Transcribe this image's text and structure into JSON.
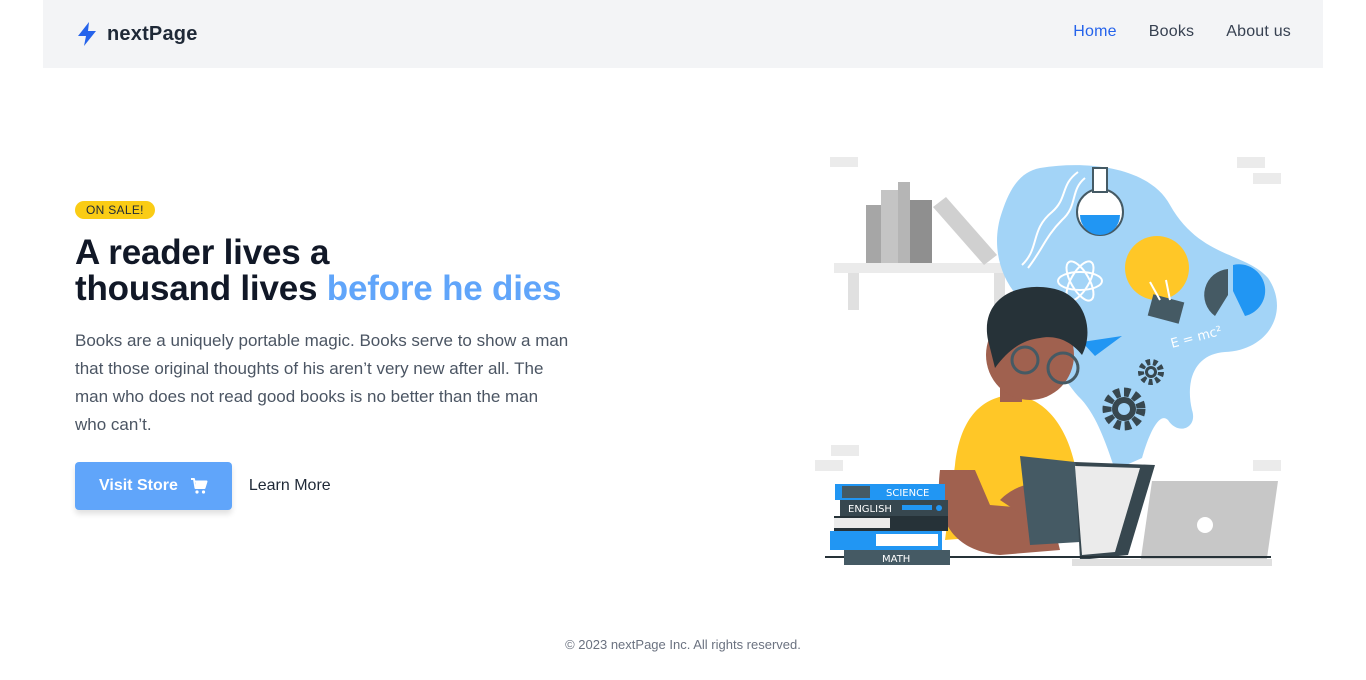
{
  "brand": {
    "name": "nextPage",
    "icon": "lightning-bolt-icon",
    "color": "#2563eb"
  },
  "nav": {
    "items": [
      {
        "label": "Home",
        "active": true
      },
      {
        "label": "Books",
        "active": false
      },
      {
        "label": "About us",
        "active": false
      }
    ]
  },
  "hero": {
    "badge": "ON SALE!",
    "headline_part1": "A reader lives a",
    "headline_part2": "thousand lives ",
    "headline_accent": "before he dies",
    "description": "Books are a uniquely portable magic. Books serve to show a man that those original thoughts of his aren’t very new after all. The man who does not read good books is no better than the man who can’t.",
    "primary_button": "Visit Store",
    "primary_button_icon": "shopping-cart-icon",
    "secondary_button": "Learn More"
  },
  "illustration": {
    "books": [
      "SCIENCE",
      "ENGLISH",
      "MATH"
    ],
    "formula": "E = mc²"
  },
  "footer": {
    "text": "© 2023 nextPage Inc. All rights reserved."
  },
  "colors": {
    "accent": "#60a5fa",
    "nav_active": "#2563eb",
    "badge": "#facc15",
    "navbar_bg": "#f3f4f6"
  }
}
